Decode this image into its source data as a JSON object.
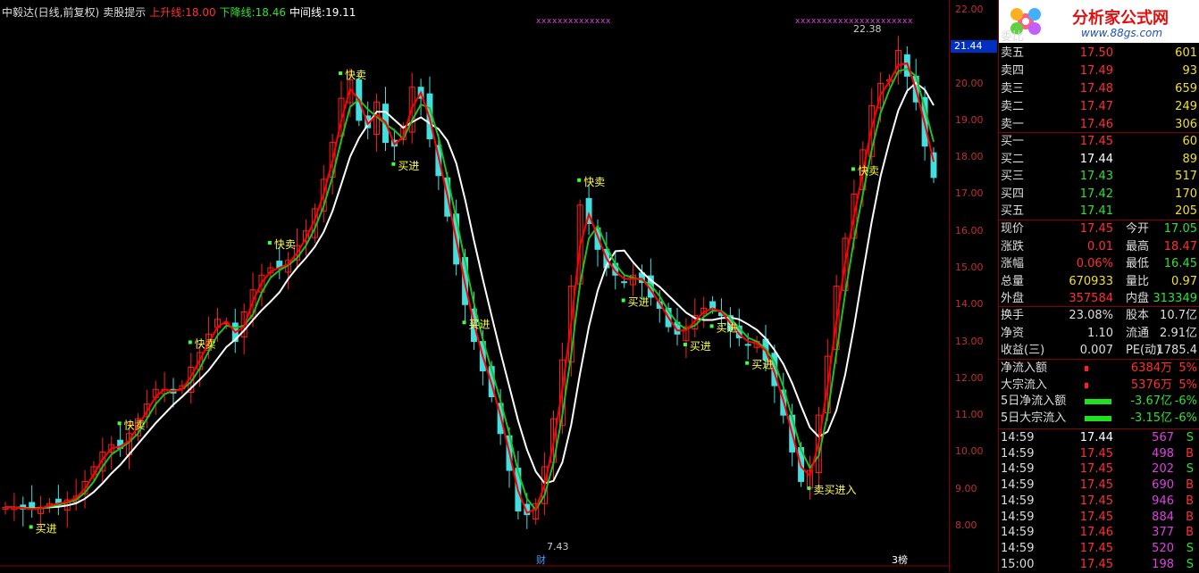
{
  "header": {
    "stock": "中毅达(日线,前复权)",
    "indicator": "卖股提示",
    "up_label": "上升线:",
    "up_value": "18.00",
    "down_label": "下降线:",
    "down_value": "18.46",
    "mid_label": "中间线:",
    "mid_value": "19.11"
  },
  "colors": {
    "up": "#ff2020",
    "down": "#40e0e0",
    "line_red": "#ff0000",
    "line_green": "#20c020",
    "line_white": "#ffffff",
    "signal": "#ffff40",
    "accent": "#ff3030"
  },
  "price_axis": {
    "ticks": [
      "22.00",
      "21.00",
      "20.00",
      "19.00",
      "18.00",
      "17.00",
      "16.00",
      "15.00",
      "14.00",
      "13.00",
      "12.00",
      "11.00",
      "10.00",
      "9.00",
      "8.00"
    ],
    "current_tag": "21.44"
  },
  "annotations": {
    "high_label": "22.38",
    "low_label": "7.43",
    "cai_label": "财",
    "zuo_label": "3榜",
    "signals": [
      {
        "text": "买进"
      },
      {
        "text": "快卖"
      },
      {
        "text": "快卖"
      },
      {
        "text": "快卖"
      },
      {
        "text": "快卖"
      },
      {
        "text": "买进"
      },
      {
        "text": "买进"
      },
      {
        "text": "快卖"
      },
      {
        "text": "买进"
      },
      {
        "text": "买进"
      },
      {
        "text": "买进"
      },
      {
        "text": "买进"
      },
      {
        "text": "快卖"
      },
      {
        "text": "卖买进入"
      }
    ]
  },
  "chart_data": {
    "type": "candlestick",
    "ylim": [
      7.3,
      22.4
    ],
    "close": [
      8.5,
      8.5,
      8.45,
      8.45,
      8.5,
      8.6,
      8.6,
      8.7,
      8.8,
      9.2,
      9.6,
      10.0,
      10.2,
      10.1,
      10.5,
      10.9,
      11.3,
      11.7,
      11.7,
      11.6,
      11.8,
      12.3,
      12.7,
      13.2,
      13.6,
      13.5,
      13.0,
      13.8,
      14.4,
      14.8,
      15.0,
      15.0,
      15.2,
      15.6,
      16.0,
      16.6,
      17.4,
      18.4,
      19.6,
      20.1,
      19.0,
      18.8,
      19.5,
      18.4,
      18.3,
      18.8,
      19.9,
      19.6,
      18.5,
      17.5,
      16.4,
      15.1,
      14.0,
      13.0,
      12.2,
      11.5,
      10.5,
      9.5,
      8.4,
      8.3,
      8.6,
      9.6,
      10.9,
      12.5,
      14.5,
      16.7,
      16.2,
      15.5,
      15.0,
      14.8,
      14.6,
      14.8,
      14.6,
      14.2,
      13.9,
      13.4,
      13.2,
      13.4,
      13.7,
      13.9,
      13.9,
      13.7,
      13.3,
      13.1,
      12.9,
      13.0,
      12.5,
      11.8,
      11.0,
      10.0,
      9.2,
      9.5,
      11.0,
      12.6,
      14.5,
      15.8,
      17.0,
      18.2,
      19.4,
      20.0,
      20.1,
      20.9,
      20.2,
      19.5,
      18.3,
      17.45
    ]
  },
  "quote": {
    "logo_title": "分析家公式网",
    "logo_url": "www.88gs.com",
    "weibi_label": "委比",
    "asks": [
      {
        "label": "卖五",
        "price": "17.50",
        "vol": "601"
      },
      {
        "label": "卖四",
        "price": "17.49",
        "vol": "93"
      },
      {
        "label": "卖三",
        "price": "17.48",
        "vol": "659"
      },
      {
        "label": "卖二",
        "price": "17.47",
        "vol": "249"
      },
      {
        "label": "卖一",
        "price": "17.46",
        "vol": "306"
      }
    ],
    "bids": [
      {
        "label": "买一",
        "price": "17.45",
        "vol": "60"
      },
      {
        "label": "买二",
        "price": "17.44",
        "vol": "89"
      },
      {
        "label": "买三",
        "price": "17.43",
        "vol": "517"
      },
      {
        "label": "买四",
        "price": "17.42",
        "vol": "170"
      },
      {
        "label": "买五",
        "price": "17.41",
        "vol": "205"
      }
    ],
    "stats": [
      {
        "l1": "现价",
        "v1": "17.45",
        "l2": "今开",
        "v2": "17.05"
      },
      {
        "l1": "涨跌",
        "v1": "0.01",
        "l2": "最高",
        "v2": "18.47"
      },
      {
        "l1": "涨幅",
        "v1": "0.06%",
        "l2": "最低",
        "v2": "16.45"
      },
      {
        "l1": "总量",
        "v1": "670933",
        "l2": "量比",
        "v2": "0.97"
      },
      {
        "l1": "外盘",
        "v1": "357584",
        "l2": "内盘",
        "v2": "313349"
      }
    ],
    "stats2": [
      {
        "l1": "换手",
        "v1": "23.08%",
        "l2": "股本",
        "v2": "10.7亿"
      },
      {
        "l1": "净资",
        "v1": "1.10",
        "l2": "流通",
        "v2": "2.91亿"
      },
      {
        "l1": "收益(三)",
        "v1": "0.007",
        "l2": "PE(动)",
        "v2": "1785.4"
      }
    ],
    "flows": [
      {
        "label": "净流入额",
        "value": "6384万",
        "pct": "5%"
      },
      {
        "label": "大宗流入",
        "value": "5376万",
        "pct": "5%"
      },
      {
        "label": "5日净流入额",
        "value": "-3.67亿",
        "pct": "-6%"
      },
      {
        "label": "5日大宗流入",
        "value": "-3.15亿",
        "pct": "-6%"
      }
    ],
    "ticks": [
      {
        "time": "14:59",
        "price": "17.44",
        "vol": "567",
        "side": "S"
      },
      {
        "time": "14:59",
        "price": "17.45",
        "vol": "498",
        "side": "B"
      },
      {
        "time": "14:59",
        "price": "17.45",
        "vol": "202",
        "side": "S"
      },
      {
        "time": "14:59",
        "price": "17.45",
        "vol": "690",
        "side": "B"
      },
      {
        "time": "14:59",
        "price": "17.45",
        "vol": "946",
        "side": "B"
      },
      {
        "time": "14:59",
        "price": "17.45",
        "vol": "884",
        "side": "B"
      },
      {
        "time": "14:59",
        "price": "17.46",
        "vol": "377",
        "side": "B"
      },
      {
        "time": "14:59",
        "price": "17.45",
        "vol": "520",
        "side": "S"
      },
      {
        "time": "15:00",
        "price": "17.45",
        "vol": "198",
        "side": "S"
      }
    ]
  }
}
